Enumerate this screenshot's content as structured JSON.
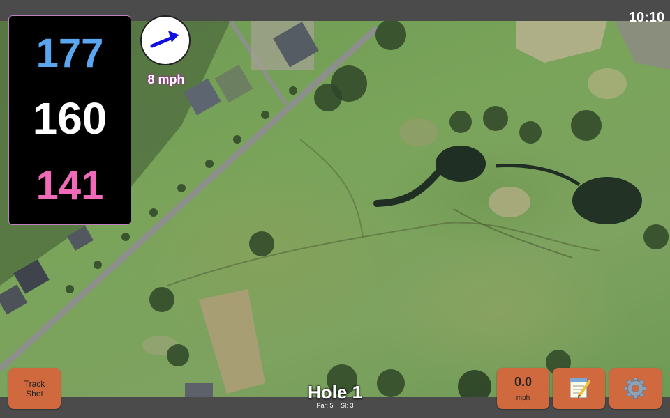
{
  "status": {
    "time": "10:10"
  },
  "distances": {
    "far": "177",
    "middle": "160",
    "near": "141"
  },
  "wind": {
    "speed_label": "8 mph",
    "icon": "arrow-right-icon"
  },
  "buttons": {
    "track_shot_line1": "Track",
    "track_shot_line2": "Shot",
    "wind_value": "0.0",
    "wind_unit": "mph",
    "notes_icon": "notepad-icon",
    "settings_icon": "gear-icon"
  },
  "hole": {
    "title": "Hole 1",
    "par": "Par: 5",
    "si": "SI: 3"
  },
  "colors": {
    "far": "#5aa6f0",
    "middle": "#ffffff",
    "near": "#f06ab8",
    "button": "#d06a3e",
    "bars": "#4b4b4b"
  }
}
